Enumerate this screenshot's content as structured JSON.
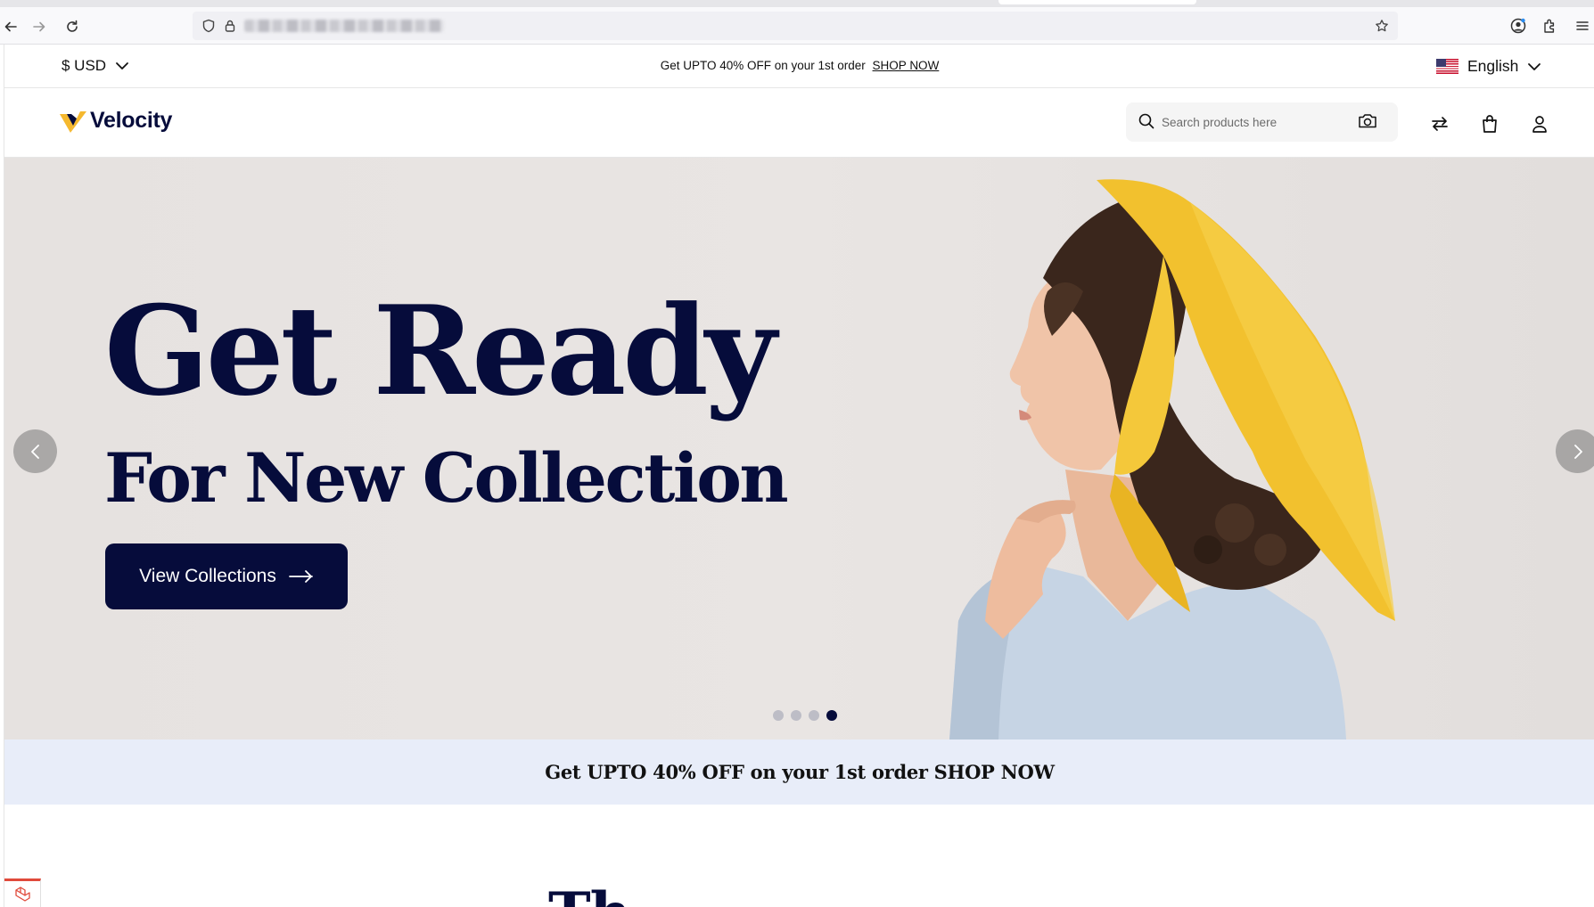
{
  "browser": {
    "url_redacted": true
  },
  "topbar": {
    "currency": "$ USD",
    "promo_text": "Get UPTO 40% OFF on your 1st order",
    "promo_link": "SHOP NOW",
    "language": "English"
  },
  "header": {
    "logo_text": "Velocity",
    "search_placeholder": "Search products here"
  },
  "hero": {
    "title": "Get Ready",
    "subtitle": "For New Collection",
    "cta_label": "View Collections",
    "slides_total": 4,
    "active_slide": 4
  },
  "offer_band": {
    "text": "Get UPTO 40% OFF on your 1st order SHOP NOW"
  },
  "section": {
    "heading_peek": "Th"
  },
  "colors": {
    "brand_navy": "#060c3b",
    "logo_yellow": "#f5b82e",
    "offer_band_bg": "#e8edf9",
    "scarf_yellow": "#f2c12e"
  },
  "icons": [
    "back-arrow-icon",
    "forward-arrow-icon",
    "reload-icon",
    "shield-icon",
    "lock-icon",
    "star-icon",
    "account-icon",
    "extensions-icon",
    "menu-icon",
    "chevron-down-icon",
    "search-icon",
    "camera-icon",
    "compare-icon",
    "cart-icon",
    "user-icon",
    "arrow-right-icon",
    "chevron-left-icon",
    "chevron-right-icon",
    "laravel-icon"
  ]
}
